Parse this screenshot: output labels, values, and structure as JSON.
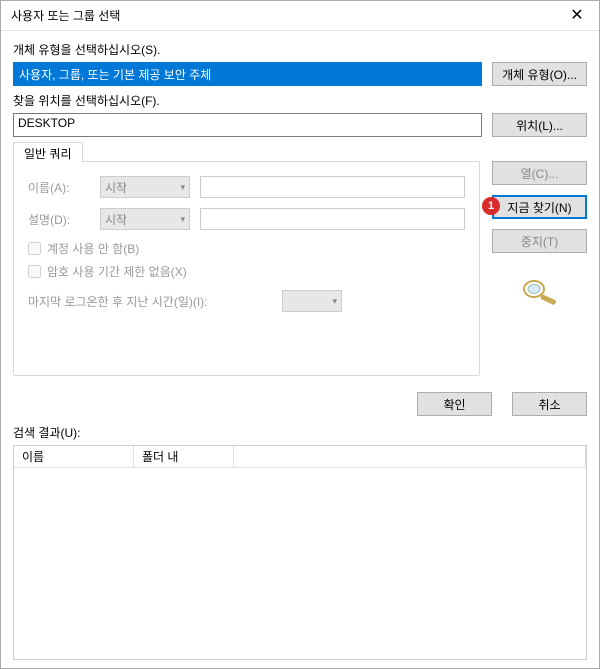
{
  "title": "사용자 또는 그룹 선택",
  "sections": {
    "objectTypeLabel": "개체 유형을 선택하십시오(S).",
    "objectTypeValue": "사용자, 그룹, 또는 기본 제공 보안 주체",
    "objectTypeButton": "개체 유형(O)...",
    "locationLabel": "찾을 위치를 선택하십시오(F).",
    "locationValue": "DESKTOP",
    "locationButton": "위치(L)..."
  },
  "query": {
    "tab": "일반 쿼리",
    "nameLabel": "이름(A):",
    "descLabel": "설명(D):",
    "combo": "시작",
    "cbDisabled": "계정 사용 안 함(B)",
    "cbNoPwExpire": "암호 사용 기간 제한 없음(X)",
    "lastLogin": "마지막 로그온한 후 지난 시간(일)(I):"
  },
  "sideButtons": {
    "columns": "열(C)...",
    "findNow": "지금 찾기(N)",
    "stop": "중지(T)"
  },
  "badge": "1",
  "bottom": {
    "ok": "확인",
    "cancel": "취소"
  },
  "results": {
    "label": "검색 결과(U):",
    "col1": "이름",
    "col2": "폴더 내"
  }
}
